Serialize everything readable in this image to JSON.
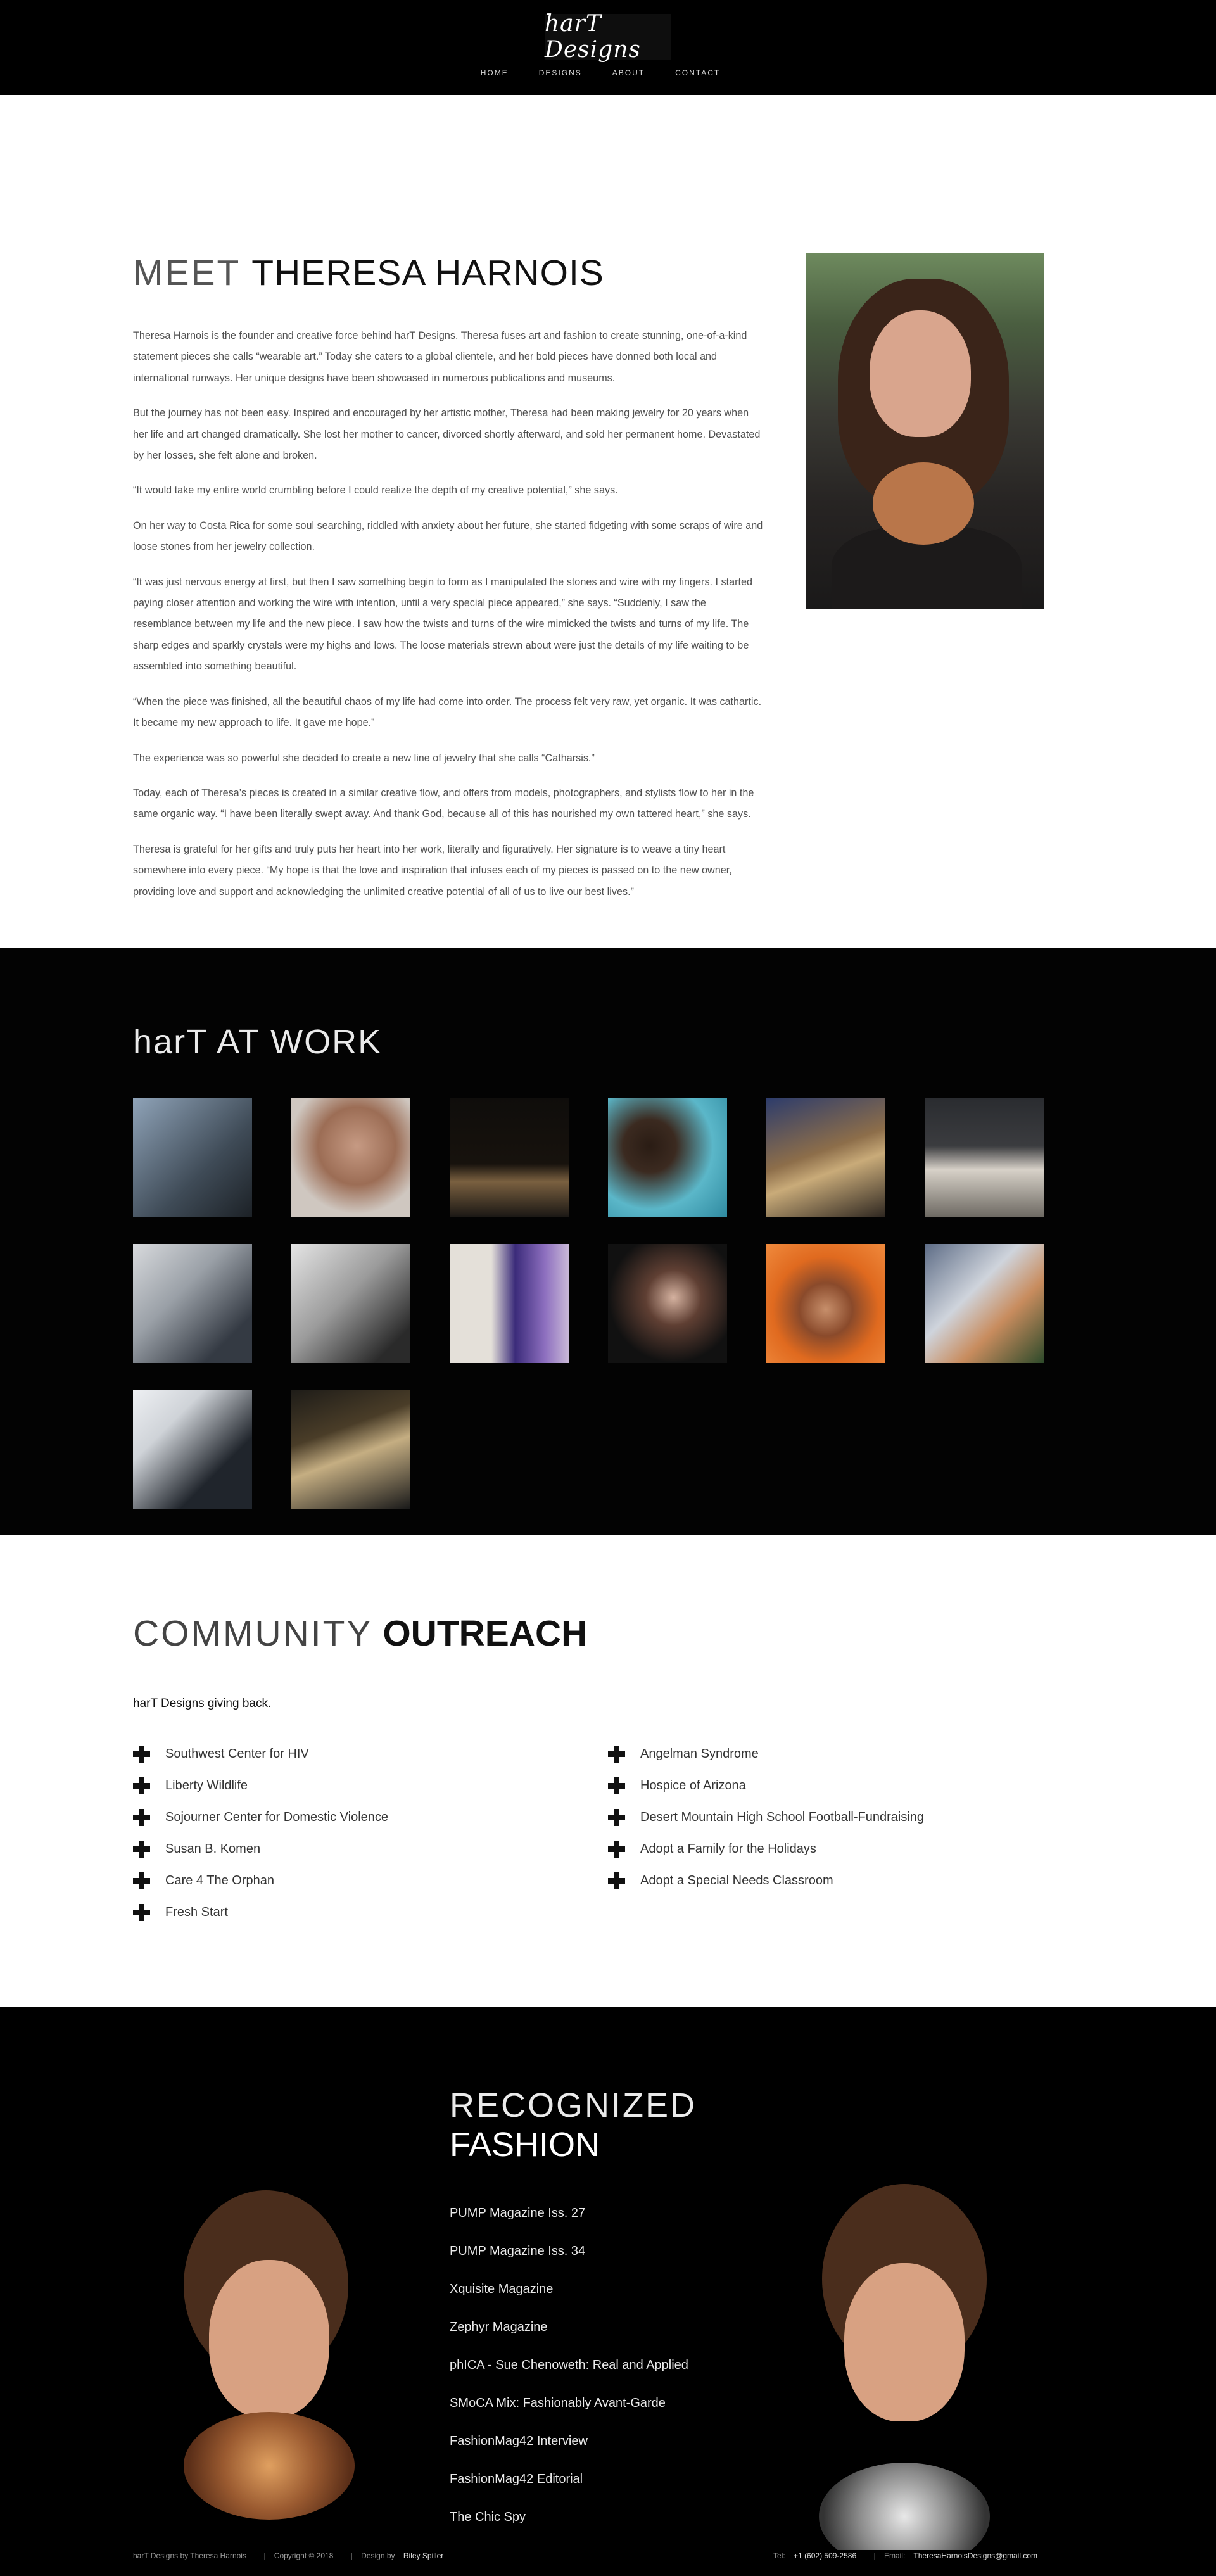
{
  "header": {
    "logo_text": "harT Designs",
    "nav": [
      "HOME",
      "DESIGNS",
      "ABOUT",
      "CONTACT"
    ]
  },
  "about": {
    "title_light": "MEET",
    "title_bold": "THERESA HARNOIS",
    "paragraphs": [
      "Theresa Harnois is the founder and creative force behind harT Designs. Theresa fuses art and fashion to create stunning, one-of-a-kind statement pieces she calls “wearable art.” Today she caters to a global clientele, and her bold pieces have donned both local and international runways. Her unique designs have been showcased in numerous publications and museums.",
      "But the journey has not been easy.  Inspired and encouraged by her artistic mother, Theresa had been making jewelry for 20 years when her life and art changed dramatically. She lost her mother to cancer, divorced shortly afterward, and sold her permanent home. Devastated by her losses, she felt alone and broken.",
      "“It would take my entire world crumbling before I could realize the depth of my creative potential,” she says.",
      "On her way to Costa Rica for some soul searching, riddled with anxiety about her future, she started fidgeting with some scraps of wire and loose stones from her jewelry collection.",
      "“It was just nervous energy at first, but then I saw something begin to form as I manipulated the stones and wire with my fingers. I started paying closer attention and working the wire with intention, until a very special piece appeared,” she says. “Suddenly, I saw the resemblance between my life and the new piece. I saw how the twists and turns of the wire mimicked the twists and turns of my life. The sharp edges and sparkly crystals were my highs and lows. The loose materials strewn about were just the details of my life waiting to be assembled into something beautiful.",
      "“When the piece was finished, all the beautiful chaos of my life had come into order. The process felt very raw, yet organic. It was cathartic. It became my new approach to life. It gave me hope.”",
      "The experience was so powerful she decided to create a new line of jewelry that she calls “Catharsis.”",
      "Today, each of Theresa’s pieces is created in a similar creative flow, and offers from models, photographers, and stylists flow to her in the same organic way. “I have been literally swept away. And thank God, because all of this has nourished my own tattered heart,” she says.",
      "Theresa is grateful for her gifts and truly puts her heart into her work, literally and figuratively. Her signature is to weave a tiny heart somewhere into every piece. “My hope is that the love and inspiration that infuses each of my pieces is passed on to the new owner, providing love and support and acknowledging the unlimited creative potential of all of us to live our best lives.”"
    ]
  },
  "work": {
    "title": "harT AT WORK",
    "thumbnail_count": 14
  },
  "community": {
    "title_light": "COMMUNITY",
    "title_bold": "OUTREACH",
    "subtitle": "harT Designs giving back.",
    "left_items": [
      "Southwest Center for HIV",
      "Liberty Wildlife",
      "Sojourner Center for Domestic Violence",
      "Susan B. Komen",
      "Care 4 The Orphan",
      "Fresh Start"
    ],
    "right_items": [
      "Angelman Syndrome",
      "Hospice of Arizona",
      "Desert Mountain High School Football-Fundraising",
      "Adopt a Family for the Holidays",
      "Adopt a Special Needs Classroom"
    ]
  },
  "recognized": {
    "title_light": "RECOGNIZED",
    "title_bold": "FASHION",
    "items": [
      "PUMP Magazine Iss. 27",
      "PUMP Magazine Iss. 34",
      "Xquisite Magazine",
      "Zephyr Magazine",
      "phICA - Sue Chenoweth: Real and Applied",
      "SMoCA Mix: Fashionably Avant-Garde",
      "FashionMag42 Interview",
      "FashionMag42 Editorial",
      "The Chic Spy"
    ]
  },
  "footer": {
    "site": "harT Designs by Theresa Harnois",
    "copyright": "Copyright © 2018",
    "design_label": "Design by",
    "design_name": "Riley Spiller",
    "tel_label": "Tel:",
    "tel": "+1 (602) 509-2586",
    "email_label": "Email:",
    "email": "TheresaHarnoisDesigns@gmail.com"
  },
  "colors": {
    "header_bg": "#000000",
    "section_dark": "#030303",
    "section_light": "#ffffff"
  }
}
